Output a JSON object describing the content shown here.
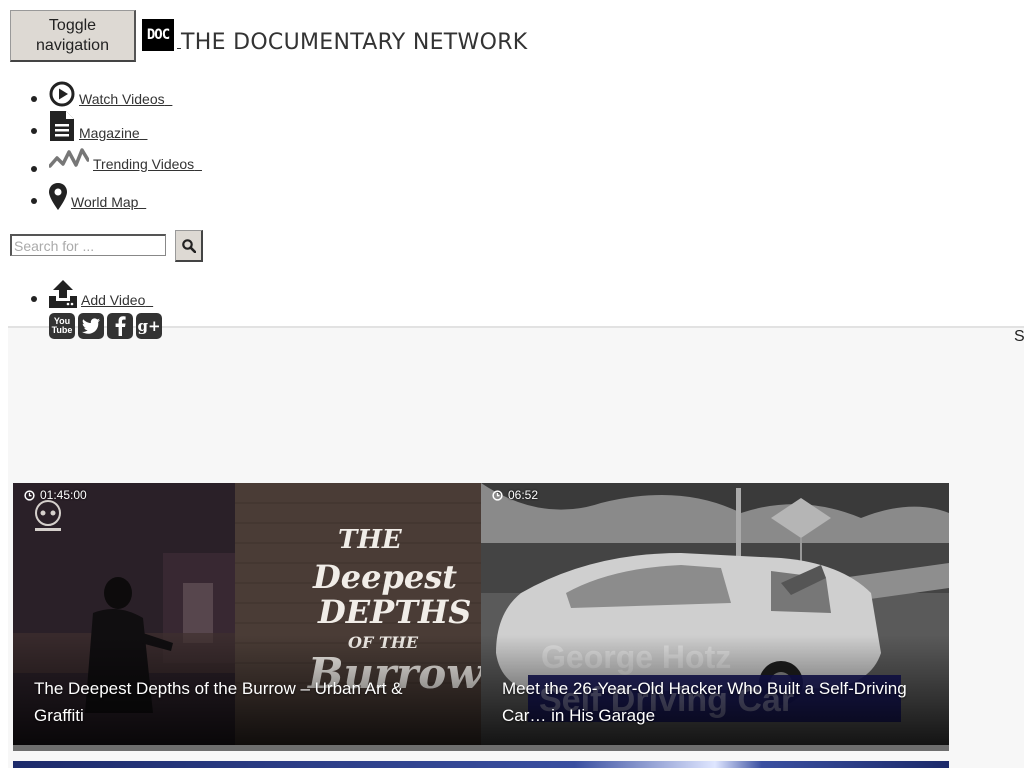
{
  "header": {
    "toggle_label": "Toggle navigation",
    "logo_text": "DOC",
    "site_name": "THE DOCUMENTARY NETWORK"
  },
  "nav": {
    "items": [
      {
        "label": "Watch Videos",
        "icon": "play-circle-icon"
      },
      {
        "label": "Magazine",
        "icon": "document-icon"
      },
      {
        "label": "Trending Videos",
        "icon": "trending-icon"
      },
      {
        "label": "World Map",
        "icon": "map-marker-icon"
      }
    ]
  },
  "search": {
    "placeholder": "Search for ...",
    "button_icon": "search-icon"
  },
  "add_video": {
    "label": "Add Video",
    "icon": "upload-icon"
  },
  "social": [
    {
      "icon": "youtube-icon",
      "text": "You Tube"
    },
    {
      "icon": "twitter-icon"
    },
    {
      "icon": "facebook-icon"
    },
    {
      "icon": "google-plus-icon"
    }
  ],
  "side_letter": "S",
  "cards": [
    {
      "duration": "01:45:00",
      "title": "The Deepest Depths of the Burrow – Urban Art & Graffiti"
    },
    {
      "duration": "06:52",
      "title": "Meet the 26-Year-Old Hacker Who Built a Self-Driving Car… in His Garage"
    }
  ]
}
